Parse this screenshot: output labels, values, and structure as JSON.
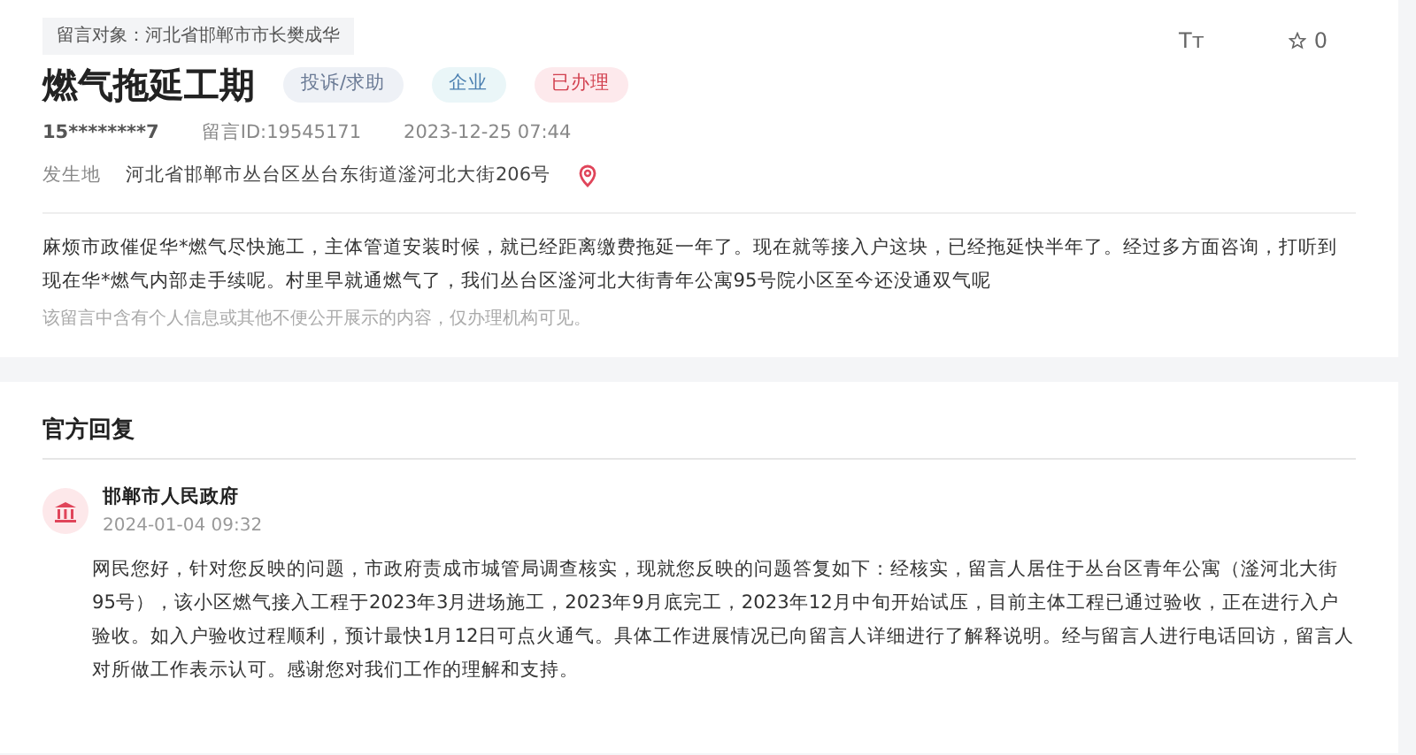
{
  "message": {
    "target": "留言对象：河北省邯郸市市长樊成华",
    "title": "燃气拖延工期",
    "tags": [
      {
        "label": "投诉/求助",
        "kind": "type"
      },
      {
        "label": "企业",
        "kind": "domain"
      },
      {
        "label": "已办理",
        "kind": "status"
      }
    ],
    "font_size_button": "Tт",
    "favorite": {
      "count": "0"
    },
    "author": "15********7",
    "message_id": "留言ID:19545171",
    "time": "2023-12-25 07:44",
    "location_label": "发生地",
    "location": "河北省邯郸市丛台区丛台东街道滏河北大街206号",
    "body": "麻烦市政催促华*燃气尽快施工，主体管道安装时候，就已经距离缴费拖延一年了。现在就等接入户这块，已经拖延快半年了。经过多方面咨询，打听到现在华*燃气内部走手续呢。村里早就通燃气了，我们丛台区滏河北大街青年公寓95号院小区至今还没通双气呢",
    "privacy_note": "该留言中含有个人信息或其他不便公开展示的内容，仅办理机构可见。"
  },
  "reply": {
    "heading": "官方回复",
    "organization": "邯郸市人民政府",
    "time": "2024-01-04 09:32",
    "body": "网民您好，针对您反映的问题，市政府责成市城管局调查核实，现就您反映的问题答复如下：经核实，留言人居住于丛台区青年公寓（滏河北大街95号），该小区燃气接入工程于2023年3月进场施工，2023年9月底完工，2023年12月中旬开始试压，目前主体工程已通过验收，正在进行入户验收。如入户验收过程顺利，预计最快1月12日可点火通气。具体工作进展情况已向留言人详细进行了解释说明。经与留言人进行电话回访，留言人对所做工作表示认可。感谢您对我们工作的理解和支持。"
  }
}
